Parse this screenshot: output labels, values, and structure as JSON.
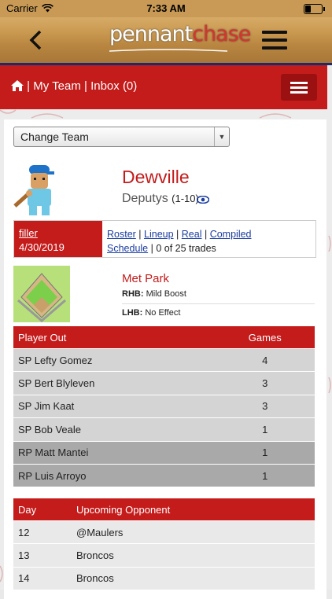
{
  "status": {
    "carrier": "Carrier",
    "time": "7:33 AM"
  },
  "header": {
    "logo_part1": "pennant",
    "logo_part2": "chase",
    "back_icon": "chevron-left-icon",
    "menu_icon": "hamburger-icon"
  },
  "nav": {
    "sep1": "|",
    "my_team": "My Team",
    "sep2": "|",
    "inbox": "Inbox (0)"
  },
  "select": {
    "value": "Change Team"
  },
  "team": {
    "city": "Dewville",
    "name": "Deputys",
    "record": "(1-10)"
  },
  "league": {
    "name": "filler",
    "date": "4/30/2019",
    "links": {
      "roster": "Roster",
      "lineup": "Lineup",
      "real": "Real",
      "compiled": "Compiled",
      "schedule": "Schedule"
    },
    "trades": "0 of 25 trades"
  },
  "park": {
    "name": "Met Park",
    "rhb_label": "RHB:",
    "rhb_value": "Mild Boost",
    "lhb_label": "LHB:",
    "lhb_value": "No Effect"
  },
  "players_table": {
    "headers": [
      "Player Out",
      "Games"
    ],
    "rows": [
      {
        "player": "SP Lefty Gomez",
        "games": "4"
      },
      {
        "player": "SP Bert Blyleven",
        "games": "3"
      },
      {
        "player": "SP Jim Kaat",
        "games": "3"
      },
      {
        "player": "SP Bob Veale",
        "games": "1"
      },
      {
        "player": "RP Matt Mantei",
        "games": "1"
      },
      {
        "player": "RP Luis Arroyo",
        "games": "1"
      }
    ]
  },
  "schedule_table": {
    "headers": [
      "Day",
      "Upcoming Opponent"
    ],
    "rows": [
      {
        "day": "12",
        "opponent": "@Maulers"
      },
      {
        "day": "13",
        "opponent": "Broncos"
      },
      {
        "day": "14",
        "opponent": "Broncos"
      }
    ]
  },
  "colors": {
    "accent": "#c41b1b",
    "link": "#1a3da0",
    "header_border": "#1b2a6b"
  }
}
